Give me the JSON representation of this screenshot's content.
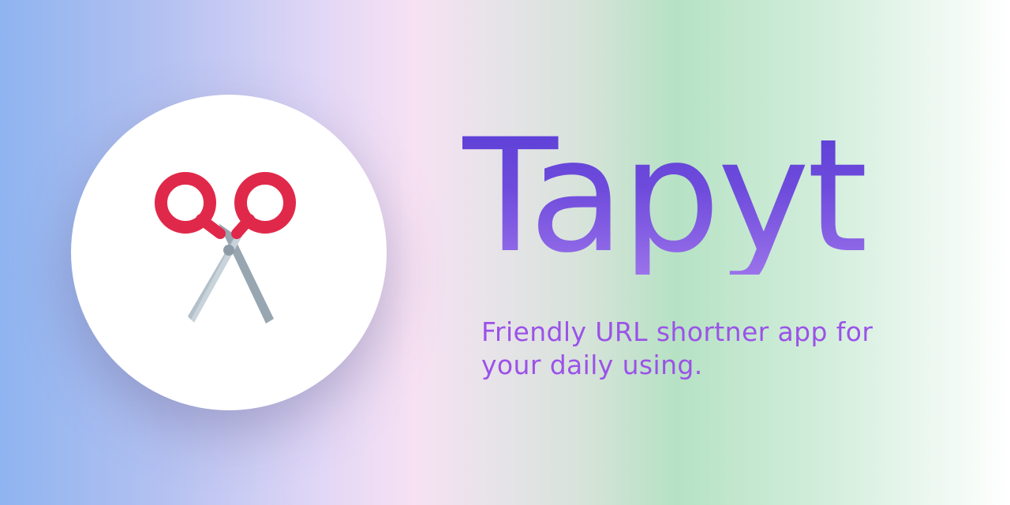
{
  "app": {
    "title": "Tapyt",
    "tagline": "Friendly URL shortner app for your daily using."
  },
  "logo": {
    "icon": "scissors-icon",
    "handle_color": "#e0294a",
    "blade_color": "#c9d3da",
    "blade_shadow_color": "#97a6b1"
  },
  "colors": {
    "title_top": "#5b3ed6",
    "title_bottom": "#9a72ea",
    "tagline": "#9b52e8",
    "gradient_left": "#8fb4f0",
    "gradient_pink": "#f7e1f3",
    "gradient_green": "#b6e2c4",
    "gradient_right": "#ffffff"
  }
}
